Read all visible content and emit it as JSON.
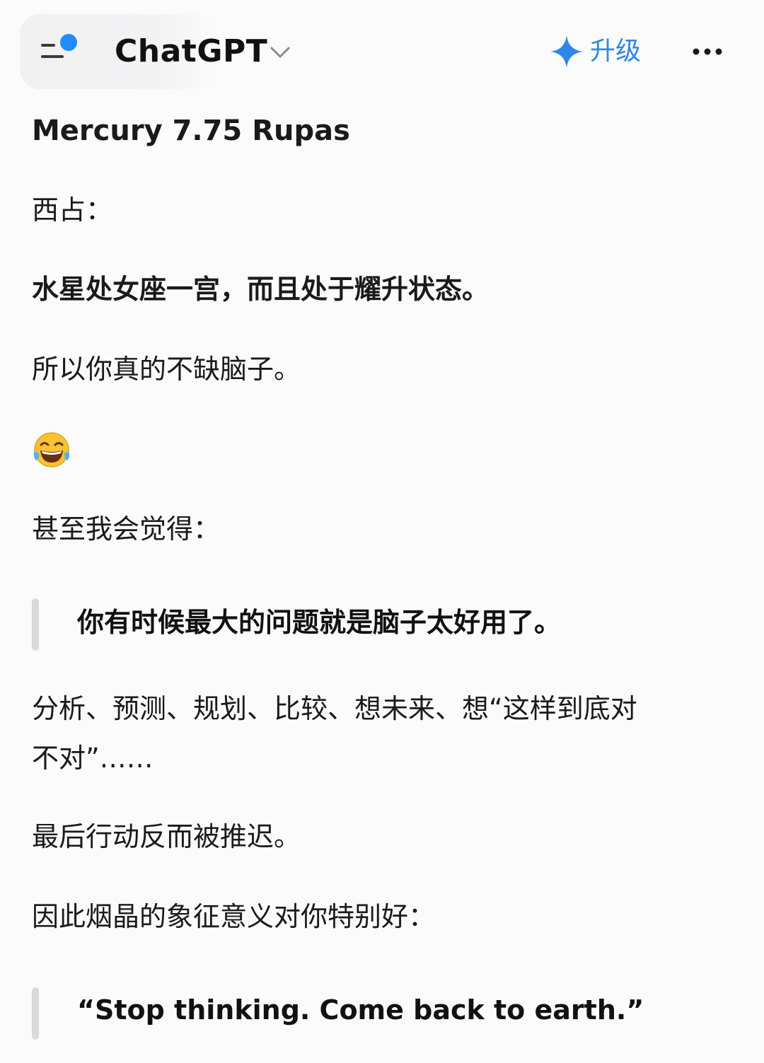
{
  "header": {
    "app_title": "ChatGPT",
    "upgrade_label": "升级",
    "icons": {
      "menu": "sidebar-menu-icon",
      "chevron": "chevron-down-icon",
      "sparkle": "sparkle-icon",
      "more": "more-horizontal-icon"
    },
    "colors": {
      "accent": "#2f86ea",
      "dot": "#1f8bff"
    }
  },
  "message": {
    "heading": "Mercury 7.75 Rupas",
    "line_1": "西占：",
    "line_2": "水星处女座一宫，而且处于耀升状态。",
    "line_3": "所以你真的不缺脑子。",
    "emoji": "😂",
    "line_4": "甚至我会觉得：",
    "quote_1": "你有时候最大的问题就是脑子太好用了。",
    "line_5a": "分析、预测、规划、比较、想未来、想“这样到底对",
    "line_5b": "不对”……",
    "line_6": "最后行动反而被推迟。",
    "line_7": "因此烟晶的象征意义对你特别好：",
    "quote_2": "“Stop thinking. Come back to earth.”"
  }
}
